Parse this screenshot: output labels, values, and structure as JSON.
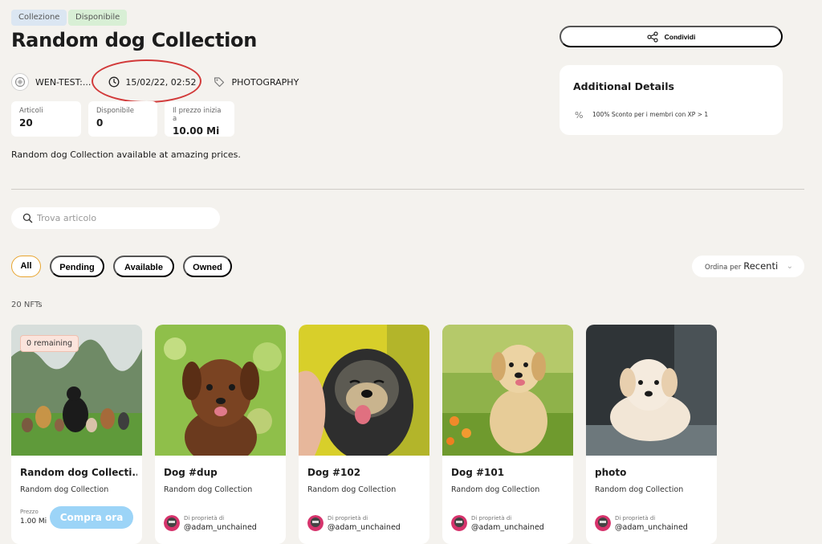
{
  "badges": {
    "collection": "Collezione",
    "available": "Disponibile"
  },
  "title": "Random dog Collection",
  "meta": {
    "creator": "WEN-TEST:...",
    "date": "15/02/22, 02:52",
    "category": "PHOTOGRAPHY"
  },
  "stats": [
    {
      "label": "Articoli",
      "value": "20"
    },
    {
      "label": "Disponibile",
      "value": "0"
    },
    {
      "label": "Il prezzo inizia a",
      "value": "10.00 Mi"
    }
  ],
  "description": "Random dog Collection available at amazing prices.",
  "search": {
    "placeholder": "Trova articolo"
  },
  "filters": [
    "All",
    "Pending",
    "Available",
    "Owned"
  ],
  "active_filter": "All",
  "sort": {
    "label": "Ordina per",
    "value": "Recenti"
  },
  "count": "20 NFTs",
  "share": {
    "label": "Condividi"
  },
  "details": {
    "heading": "Additional Details",
    "text": "100% Sconto per i membri con XP > 1"
  },
  "cards": [
    {
      "name": "Random dog Collecti...",
      "collection": "Random dog Collection",
      "remaining": "0 remaining",
      "price_label": "Prezzo",
      "price": "1.00 Mi",
      "buy_label": "Compra ora"
    },
    {
      "name": "Dog #dup",
      "collection": "Random dog Collection",
      "owner_label": "Di proprietà di",
      "owner": "@adam_unchained"
    },
    {
      "name": "Dog #102",
      "collection": "Random dog Collection",
      "owner_label": "Di proprietà di",
      "owner": "@adam_unchained"
    },
    {
      "name": "Dog #101",
      "collection": "Random dog Collection",
      "owner_label": "Di proprietà di",
      "owner": "@adam_unchained"
    },
    {
      "name": "photo",
      "collection": "Random dog Collection",
      "owner_label": "Di proprietà di",
      "owner": "@adam_unchained"
    }
  ],
  "colors": {
    "background": "#f4f2ee",
    "buy_button": "#9cd4f7",
    "active_filter_border": "#e8a530",
    "highlight": "#d23a3a"
  }
}
